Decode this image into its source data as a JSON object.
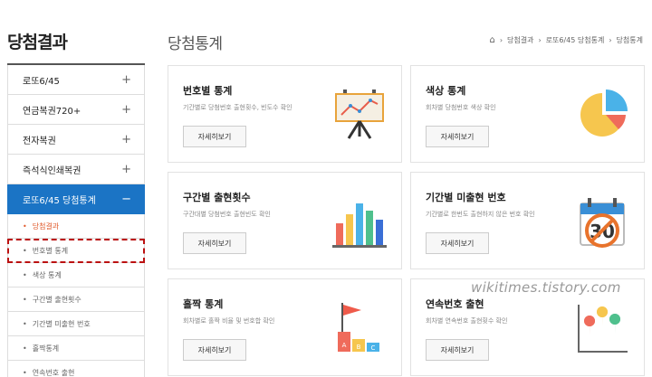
{
  "sidebar": {
    "title": "당첨결과",
    "items": [
      {
        "label": "로또6/45",
        "toggle": "+"
      },
      {
        "label": "연금복권720+",
        "toggle": "+"
      },
      {
        "label": "전자복권",
        "toggle": "+"
      },
      {
        "label": "즉석식인쇄복권",
        "toggle": "+"
      },
      {
        "label": "로또6/45 당첨통계",
        "toggle": "−"
      }
    ],
    "subitems": [
      "당첨결과",
      "번호별 통계",
      "색상 통계",
      "구간별 출현횟수",
      "기간별 미출현 번호",
      "홀짝통계",
      "연속번호 출현"
    ]
  },
  "main": {
    "title": "당첨통계",
    "breadcrumb": [
      "당첨결과",
      "로또6/45 당첨통계",
      "당첨통계"
    ]
  },
  "cards": [
    {
      "title": "번호별 통계",
      "desc": "기간별로 당첨번호 출현횟수, 빈도수 확인",
      "button": "자세히보기",
      "icon": "presentation-board-icon"
    },
    {
      "title": "색상 통계",
      "desc": "회차별 당첨번호 색상 확인",
      "button": "자세히보기",
      "icon": "pie-chart-icon"
    },
    {
      "title": "구간별 출현횟수",
      "desc": "구간대별 당첨번호 출현빈도 확인",
      "button": "자세히보기",
      "icon": "bar-chart-icon"
    },
    {
      "title": "기간별 미출현 번호",
      "desc": "기간별로 한번도 출현하지 않은 번호 확인",
      "button": "자세히보기",
      "icon": "calendar-30-icon"
    },
    {
      "title": "홀짝 통계",
      "desc": "회차별로 홀짝 비율 및 번호합 확인",
      "button": "자세히보기",
      "icon": "flag-abc-icon"
    },
    {
      "title": "연속번호 출현",
      "desc": "회차별 연속번호 출현횟수 확인",
      "button": "자세히보기",
      "icon": "map-pins-chart-icon"
    }
  ],
  "watermark": "wikitimes.tistory.com",
  "colors": {
    "active_menu": "#1b74c5",
    "current_sub": "#e05a2b",
    "highlight_border": "#b11111"
  }
}
